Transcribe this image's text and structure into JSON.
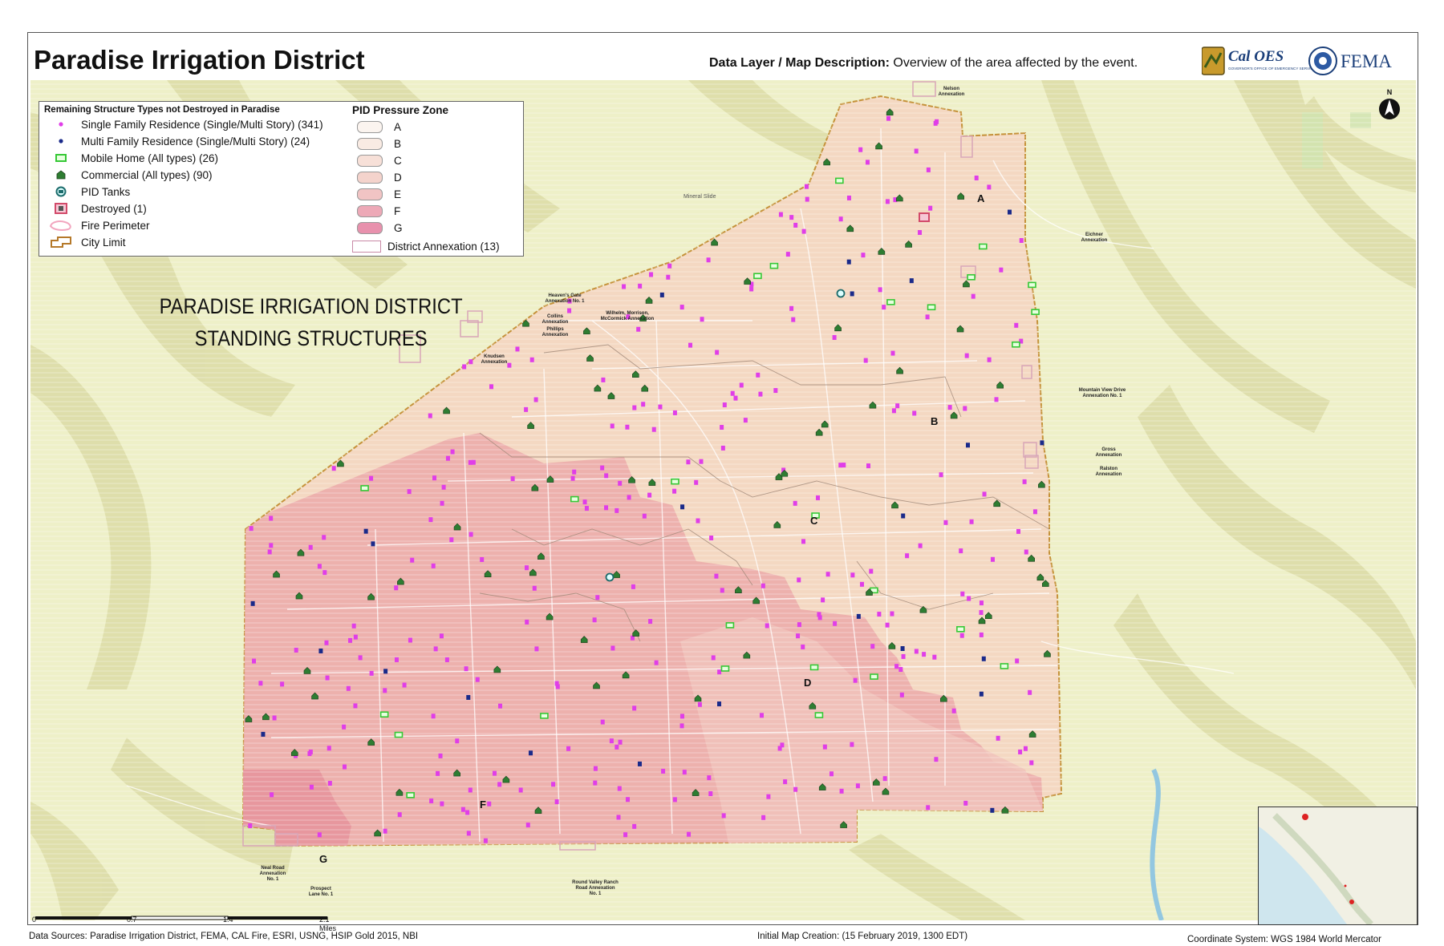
{
  "header": {
    "title": "Paradise Irrigation District",
    "description_label": "Data Layer / Map Description:",
    "description_text": "Overview of the area affected by the event.",
    "logo_caloes": "Cal OES",
    "logo_caloes_sub": "GOVERNOR'S OFFICE OF EMERGENCY SERVICES",
    "logo_fema": "FEMA"
  },
  "legend": {
    "structures_title": "Remaining Structure Types not Destroyed in Paradise",
    "items": [
      {
        "label": "Single Family Residence (Single/Multi Story) (341)",
        "icon": "pink-dot-icon",
        "color": "#e03ee8"
      },
      {
        "label": "Multi Family Residence (Single/Multi Story) (24)",
        "icon": "navy-dot-icon",
        "color": "#1a2a8a"
      },
      {
        "label": "Mobile Home (All types) (26)",
        "icon": "mobile-home-icon",
        "color": "#35c835"
      },
      {
        "label": "Commercial (All types) (90)",
        "icon": "commercial-icon",
        "color": "#2e7d32"
      },
      {
        "label": "PID Tanks",
        "icon": "tank-icon",
        "color": "#1b6b6b"
      },
      {
        "label": "Destroyed (1)",
        "icon": "destroyed-icon",
        "color": "#d24a6a"
      },
      {
        "label": "Fire Perimeter",
        "icon": "fire-perimeter-icon",
        "color": "#f2a6bf"
      },
      {
        "label": "City Limit",
        "icon": "city-limit-icon",
        "color": "#b5792a"
      }
    ],
    "zones_title": "PID Pressure Zone",
    "zones": [
      {
        "label": "A",
        "color": "#fbf4ef"
      },
      {
        "label": "B",
        "color": "#f9ebe3"
      },
      {
        "label": "C",
        "color": "#f7e0d8"
      },
      {
        "label": "D",
        "color": "#f4d3cc"
      },
      {
        "label": "E",
        "color": "#f1c4c4"
      },
      {
        "label": "F",
        "color": "#eda9b7"
      },
      {
        "label": "G",
        "color": "#e891ad"
      }
    ],
    "annexation_label": "District Annexation (13)"
  },
  "map": {
    "main_label_line1": "PARADISE IRRIGATION DISTRICT",
    "main_label_line2": "STANDING STRUCTURES",
    "zone_letters": [
      "A",
      "B",
      "C",
      "D",
      "F",
      "G"
    ],
    "annexations": [
      "Heaven's Gate Annexation No. 1",
      "Collins Annexation",
      "Phillips Annexation",
      "Wilhelm, Morrison, McCormick Annexation",
      "Knudsen Annexation",
      "Nelson Annexation",
      "Eichner Annexation",
      "Mountain View Drive Annexation No. 1",
      "Gross Annexation",
      "Ralston Annexation",
      "Neal Road Annexation No. 1",
      "Prospect Lane No. 1",
      "Round Valley Ranch Road Annexation No. 1"
    ],
    "features": [
      "Mineral Slide"
    ],
    "colors": {
      "terrain": "#eef0c8",
      "ridge": "#dedfa8",
      "district_fill": "#f4d8c2",
      "fire_zone": "#eaa9a6",
      "city_limit": "#c5923a"
    }
  },
  "scale": {
    "ticks": [
      "0",
      "0.7",
      "1.4",
      "2.1"
    ],
    "unit": "Miles"
  },
  "north_arrow": "N",
  "footer": {
    "sources": "Data Sources: Paradise Irrigation District, FEMA, CAL Fire, ESRI, USNG, HSIP Gold 2015, NBI",
    "creation": "Initial Map Creation: (15 February 2019, 1300 EDT)",
    "coordinate": "Coordinate System: WGS 1984 World Mercator"
  }
}
